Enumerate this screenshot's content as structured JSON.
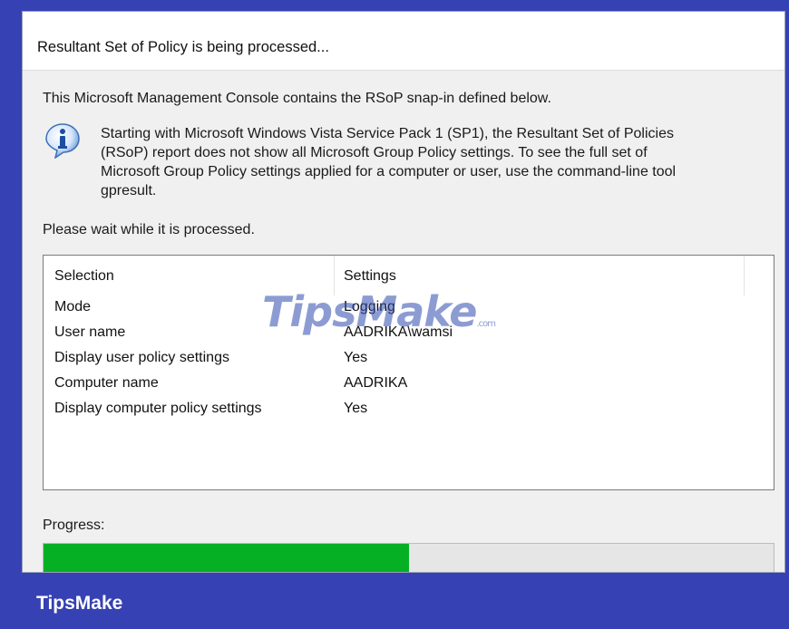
{
  "dialog": {
    "title": "Resultant Set of Policy is being processed...",
    "intro": "This Microsoft Management Console contains the RSoP snap-in defined below.",
    "info_icon": "info-icon",
    "info_lines": [
      "Starting with Microsoft Windows Vista Service Pack 1 (SP1), the Resultant Set of Policies",
      "(RSoP) report does not show all Microsoft Group Policy settings.  To see the full set of",
      "Microsoft Group Policy settings applied for a computer or user, use the command-line tool",
      "gpresult."
    ],
    "wait_text": "Please wait while it is processed."
  },
  "table": {
    "headers": [
      "Selection",
      "Settings"
    ],
    "rows": [
      [
        "Mode",
        "Logging"
      ],
      [
        "User name",
        "AADRIKA\\wamsi"
      ],
      [
        "Display user policy settings",
        "Yes"
      ],
      [
        "Computer name",
        "AADRIKA"
      ],
      [
        "Display computer policy settings",
        "Yes"
      ]
    ]
  },
  "progress": {
    "label": "Progress:",
    "fraction": 0.5,
    "color": "#06b025"
  },
  "watermark": {
    "main": "TipsMake",
    "suffix": ".com"
  },
  "brand": "TipsMake"
}
